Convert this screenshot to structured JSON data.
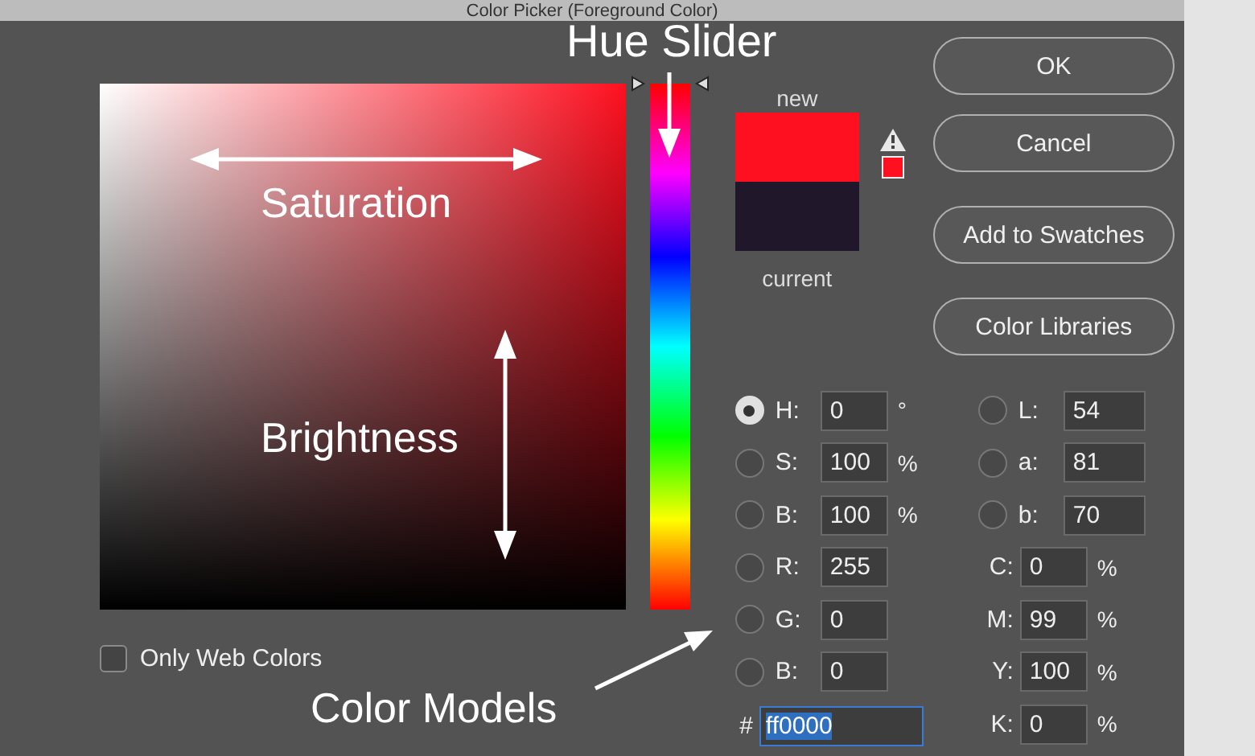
{
  "window": {
    "title": "Color Picker (Foreground Color)"
  },
  "hue_slider": {
    "level": 1
  },
  "swatches": [
    {
      "label": "new",
      "color": "#ff1020"
    },
    {
      "label": "current",
      "color": "#21172a"
    }
  ],
  "buttons": [
    "OK",
    "Cancel",
    "Add to Swatches",
    "Color Libraries"
  ],
  "hsb_fields": [
    {
      "label": "H:",
      "value": "0",
      "unit": "°",
      "selected": true
    },
    {
      "label": "S:",
      "value": "100",
      "unit": "%",
      "selected": false
    },
    {
      "label": "B:",
      "value": "100",
      "unit": "%",
      "selected": false
    }
  ],
  "rgb_fields": [
    {
      "label": "R:",
      "value": "255",
      "selected": false
    },
    {
      "label": "G:",
      "value": "0",
      "selected": false
    },
    {
      "label": "B:",
      "value": "0",
      "selected": false
    }
  ],
  "hex_field": {
    "label": "#",
    "value": "ff0000",
    "text_selected": true
  },
  "lab_fields": [
    {
      "label": "L:",
      "value": "54",
      "selected": false
    },
    {
      "label": "a:",
      "value": "81",
      "selected": false
    },
    {
      "label": "b:",
      "value": "70",
      "selected": false
    }
  ],
  "cmyk_fields": [
    {
      "label": "C:",
      "value": "0",
      "unit": "%"
    },
    {
      "label": "M:",
      "value": "99",
      "unit": "%"
    },
    {
      "label": "Y:",
      "value": "100",
      "unit": "%"
    },
    {
      "label": "K:",
      "value": "0",
      "unit": "%"
    }
  ],
  "only_web_colors": {
    "label": "Only Web Colors",
    "checked": false
  },
  "annotations": {
    "hue_slider": "Hue Slider",
    "saturation": "Saturation",
    "brightness": "Brightness",
    "color_models": "Color Models"
  }
}
